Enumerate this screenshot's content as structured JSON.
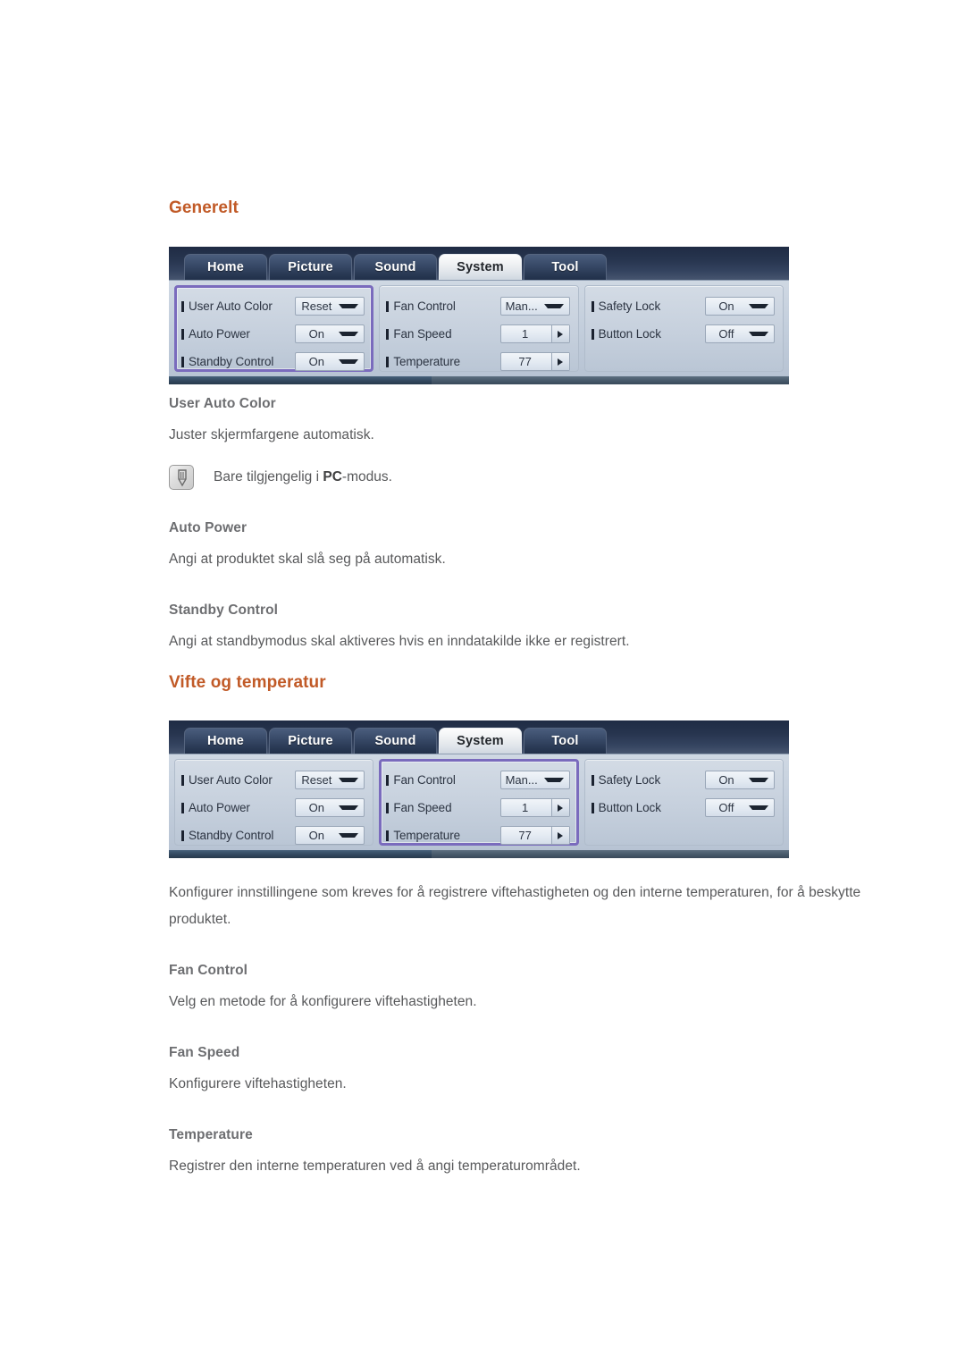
{
  "page": {
    "sections": [
      {
        "id": "generelt",
        "title": "Generelt",
        "osd": {
          "tabs": [
            {
              "label": "Home",
              "active": false
            },
            {
              "label": "Picture",
              "active": false
            },
            {
              "label": "Sound",
              "active": false
            },
            {
              "label": "System",
              "active": true
            },
            {
              "label": "Tool",
              "active": false
            }
          ],
          "highlight_column": 0,
          "columns": [
            {
              "rows": [
                {
                  "label": "User Auto Color",
                  "value": "Reset",
                  "control": "dropdown"
                },
                {
                  "label": "Auto Power",
                  "value": "On",
                  "control": "dropdown"
                },
                {
                  "label": "Standby Control",
                  "value": "On",
                  "control": "dropdown"
                }
              ]
            },
            {
              "rows": [
                {
                  "label": "Fan Control",
                  "value": "Man...",
                  "control": "dropdown"
                },
                {
                  "label": "Fan Speed",
                  "value": "1",
                  "control": "stepper"
                },
                {
                  "label": "Temperature",
                  "value": "77",
                  "control": "stepper"
                }
              ]
            },
            {
              "rows": [
                {
                  "label": "Safety Lock",
                  "value": "On",
                  "control": "dropdown"
                },
                {
                  "label": "Button Lock",
                  "value": "Off",
                  "control": "dropdown"
                }
              ]
            }
          ]
        },
        "blocks": [
          {
            "type": "subheading",
            "text": "User Auto Color"
          },
          {
            "type": "paragraph",
            "text": "Juster skjermfargene automatisk."
          },
          {
            "type": "note",
            "icon": "note-pencil-icon",
            "text_before": "Bare tilgjengelig i ",
            "text_bold": "PC",
            "text_after": "-modus."
          },
          {
            "type": "subheading",
            "text": "Auto Power"
          },
          {
            "type": "paragraph",
            "text": "Angi at produktet skal slå seg på automatisk."
          },
          {
            "type": "subheading",
            "text": "Standby Control"
          },
          {
            "type": "paragraph",
            "text": "Angi at standbymodus skal aktiveres hvis en inndatakilde ikke er registrert."
          }
        ]
      },
      {
        "id": "vifte-og-temperatur",
        "title": "Vifte og temperatur",
        "osd": {
          "tabs": [
            {
              "label": "Home",
              "active": false
            },
            {
              "label": "Picture",
              "active": false
            },
            {
              "label": "Sound",
              "active": false
            },
            {
              "label": "System",
              "active": true
            },
            {
              "label": "Tool",
              "active": false
            }
          ],
          "highlight_column": 1,
          "columns": [
            {
              "rows": [
                {
                  "label": "User Auto Color",
                  "value": "Reset",
                  "control": "dropdown"
                },
                {
                  "label": "Auto Power",
                  "value": "On",
                  "control": "dropdown"
                },
                {
                  "label": "Standby Control",
                  "value": "On",
                  "control": "dropdown"
                }
              ]
            },
            {
              "rows": [
                {
                  "label": "Fan Control",
                  "value": "Man...",
                  "control": "dropdown"
                },
                {
                  "label": "Fan Speed",
                  "value": "1",
                  "control": "stepper"
                },
                {
                  "label": "Temperature",
                  "value": "77",
                  "control": "stepper"
                }
              ]
            },
            {
              "rows": [
                {
                  "label": "Safety Lock",
                  "value": "On",
                  "control": "dropdown"
                },
                {
                  "label": "Button Lock",
                  "value": "Off",
                  "control": "dropdown"
                }
              ]
            }
          ]
        },
        "blocks": [
          {
            "type": "paragraph",
            "text": "Konfigurer innstillingene som kreves for å registrere viftehastigheten og den interne temperaturen, for å beskytte produktet."
          },
          {
            "type": "subheading",
            "text": "Fan Control"
          },
          {
            "type": "paragraph",
            "text": "Velg en metode for å konfigurere viftehastigheten."
          },
          {
            "type": "subheading",
            "text": "Fan Speed"
          },
          {
            "type": "paragraph",
            "text": "Konfigurere viftehastigheten."
          },
          {
            "type": "subheading",
            "text": "Temperature"
          },
          {
            "type": "paragraph",
            "text": "Registrer den interne temperaturen ved å angi temperaturområdet."
          }
        ]
      }
    ]
  },
  "colors": {
    "heading": "#c15a27",
    "subheading": "#6d6e71",
    "body": "#58595b",
    "highlight_border": "#7a6bbd",
    "osd_tabbar": "#27354f"
  }
}
